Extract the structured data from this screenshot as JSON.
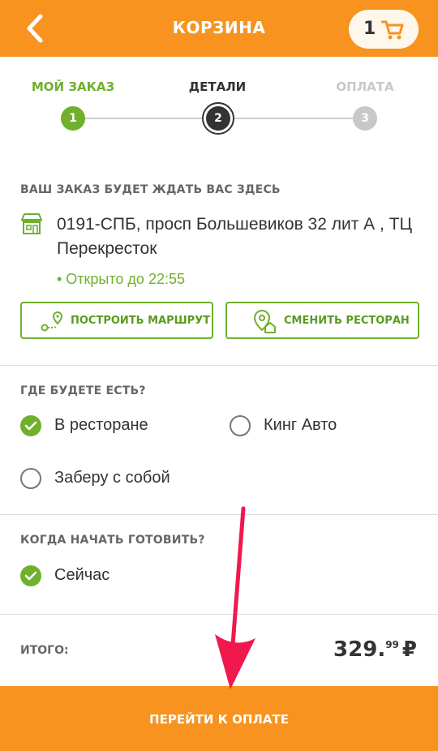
{
  "header": {
    "title": "КОРЗИНА",
    "cart_count": "1",
    "color": "#f7931e"
  },
  "steps": [
    {
      "label": "МОЙ ЗАКАЗ",
      "number": "1",
      "state": "done",
      "color": "#6fb02c"
    },
    {
      "label": "ДЕТАЛИ",
      "number": "2",
      "state": "active",
      "color": "#333333"
    },
    {
      "label": "ОПЛАТА",
      "number": "3",
      "state": "pending",
      "color": "#c8c8c8"
    }
  ],
  "pickup": {
    "title": "ВАШ ЗАКАЗ БУДЕТ ЖДАТЬ ВАС ЗДЕСЬ",
    "address": "0191-СПБ, просп Большевиков 32 лит А , ТЦ Перекресток",
    "status": "• Открыто  до 22:55",
    "route_button": "ПОСТРОИТЬ МАРШРУТ",
    "change_button": "СМЕНИТЬ РЕСТОРАН"
  },
  "dine": {
    "title": "ГДЕ БУДЕТЕ ЕСТЬ?",
    "options": [
      {
        "label": "В ресторане",
        "selected": true
      },
      {
        "label": "Кинг Авто",
        "selected": false
      },
      {
        "label": "Заберу с собой",
        "selected": false
      }
    ]
  },
  "cook": {
    "title": "КОГДА НАЧАТЬ ГОТОВИТЬ?",
    "options": [
      {
        "label": "Сейчас",
        "selected": true
      }
    ]
  },
  "total": {
    "label": "ИТОГО:",
    "rub": "329.",
    "kop": "99",
    "currency": "₽"
  },
  "pay_button": "ПЕРЕЙТИ К ОПЛАТЕ",
  "accent_green": "#6fb02c",
  "annotation_arrow_color": "#f0184d"
}
